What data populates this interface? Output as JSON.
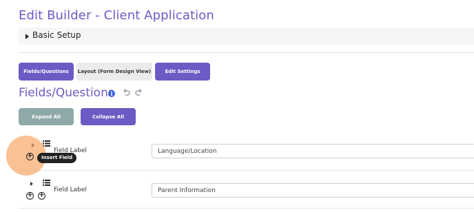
{
  "page": {
    "title": "Edit Builder - Client Application"
  },
  "basic_setup": {
    "label": "Basic Setup"
  },
  "tabs": [
    {
      "label": "Fields/Questions",
      "active": true
    },
    {
      "label": "Layout (Form Design View)",
      "active": false
    },
    {
      "label": "Edit Settings",
      "active": true
    }
  ],
  "section": {
    "title": "Fields/Questions"
  },
  "buttons": {
    "expand_all": "Expand All",
    "collapse_all": "Collapse All"
  },
  "fields": [
    {
      "label": "Field Label",
      "value": "Language/Location"
    },
    {
      "label": "Field Label",
      "value": "Parent Information"
    }
  ],
  "tooltip": {
    "text": "Insert Field"
  },
  "colors": {
    "accent": "#6b5bc4",
    "expand_button": "#8fa9a8",
    "highlight": "#f7a05a"
  },
  "icons": [
    "info-icon",
    "undo-icon",
    "redo-icon",
    "list-icon",
    "add-field-icon",
    "add-nested-field-icon"
  ]
}
